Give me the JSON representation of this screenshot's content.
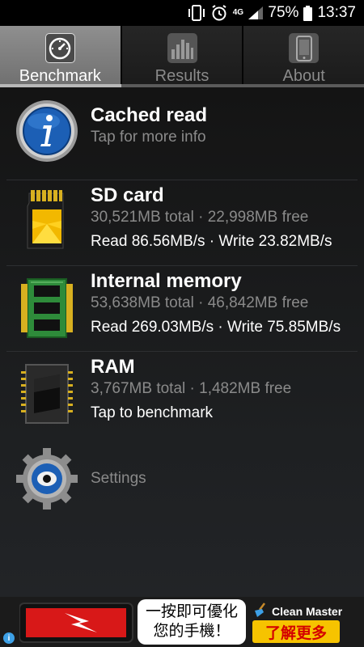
{
  "status_bar": {
    "network": "4G",
    "battery_percent": "75%",
    "time": "13:37",
    "icons": [
      "vibrate-icon",
      "alarm-icon",
      "signal-icon",
      "battery-icon"
    ]
  },
  "tabs": [
    {
      "label": "Benchmark",
      "icon": "speedometer-icon",
      "active": true
    },
    {
      "label": "Results",
      "icon": "bar-chart-icon",
      "active": false
    },
    {
      "label": "About",
      "icon": "phone-icon",
      "active": false
    }
  ],
  "items": [
    {
      "title": "Cached read",
      "subtitle": "Tap for more info",
      "icon": "info-icon"
    },
    {
      "title": "SD card",
      "subtitle": "30,521MB total · 22,998MB free",
      "detail": "Read 86.56MB/s · Write 23.82MB/s",
      "icon": "sd-card-icon"
    },
    {
      "title": "Internal memory",
      "subtitle": "53,638MB total · 46,842MB free",
      "detail": "Read 269.03MB/s · Write 75.85MB/s",
      "icon": "memory-chip-icon"
    },
    {
      "title": "RAM",
      "subtitle": "3,767MB total · 1,482MB free",
      "detail": "Tap to benchmark",
      "icon": "ram-chip-icon"
    },
    {
      "subtitle": "Settings",
      "icon": "settings-gear-icon"
    }
  ],
  "ad": {
    "bubble_line1": "一按即可優化",
    "bubble_line2": "您的手機！",
    "brand": "Clean Master",
    "cta": "了解更多",
    "info_icon": "ad-info-icon"
  },
  "colors": {
    "background": "#131313",
    "active_tab": "#7f7f7f",
    "subtitle": "#8a8a8a",
    "cta_bg": "#f6c300",
    "cta_text": "#d40000"
  }
}
